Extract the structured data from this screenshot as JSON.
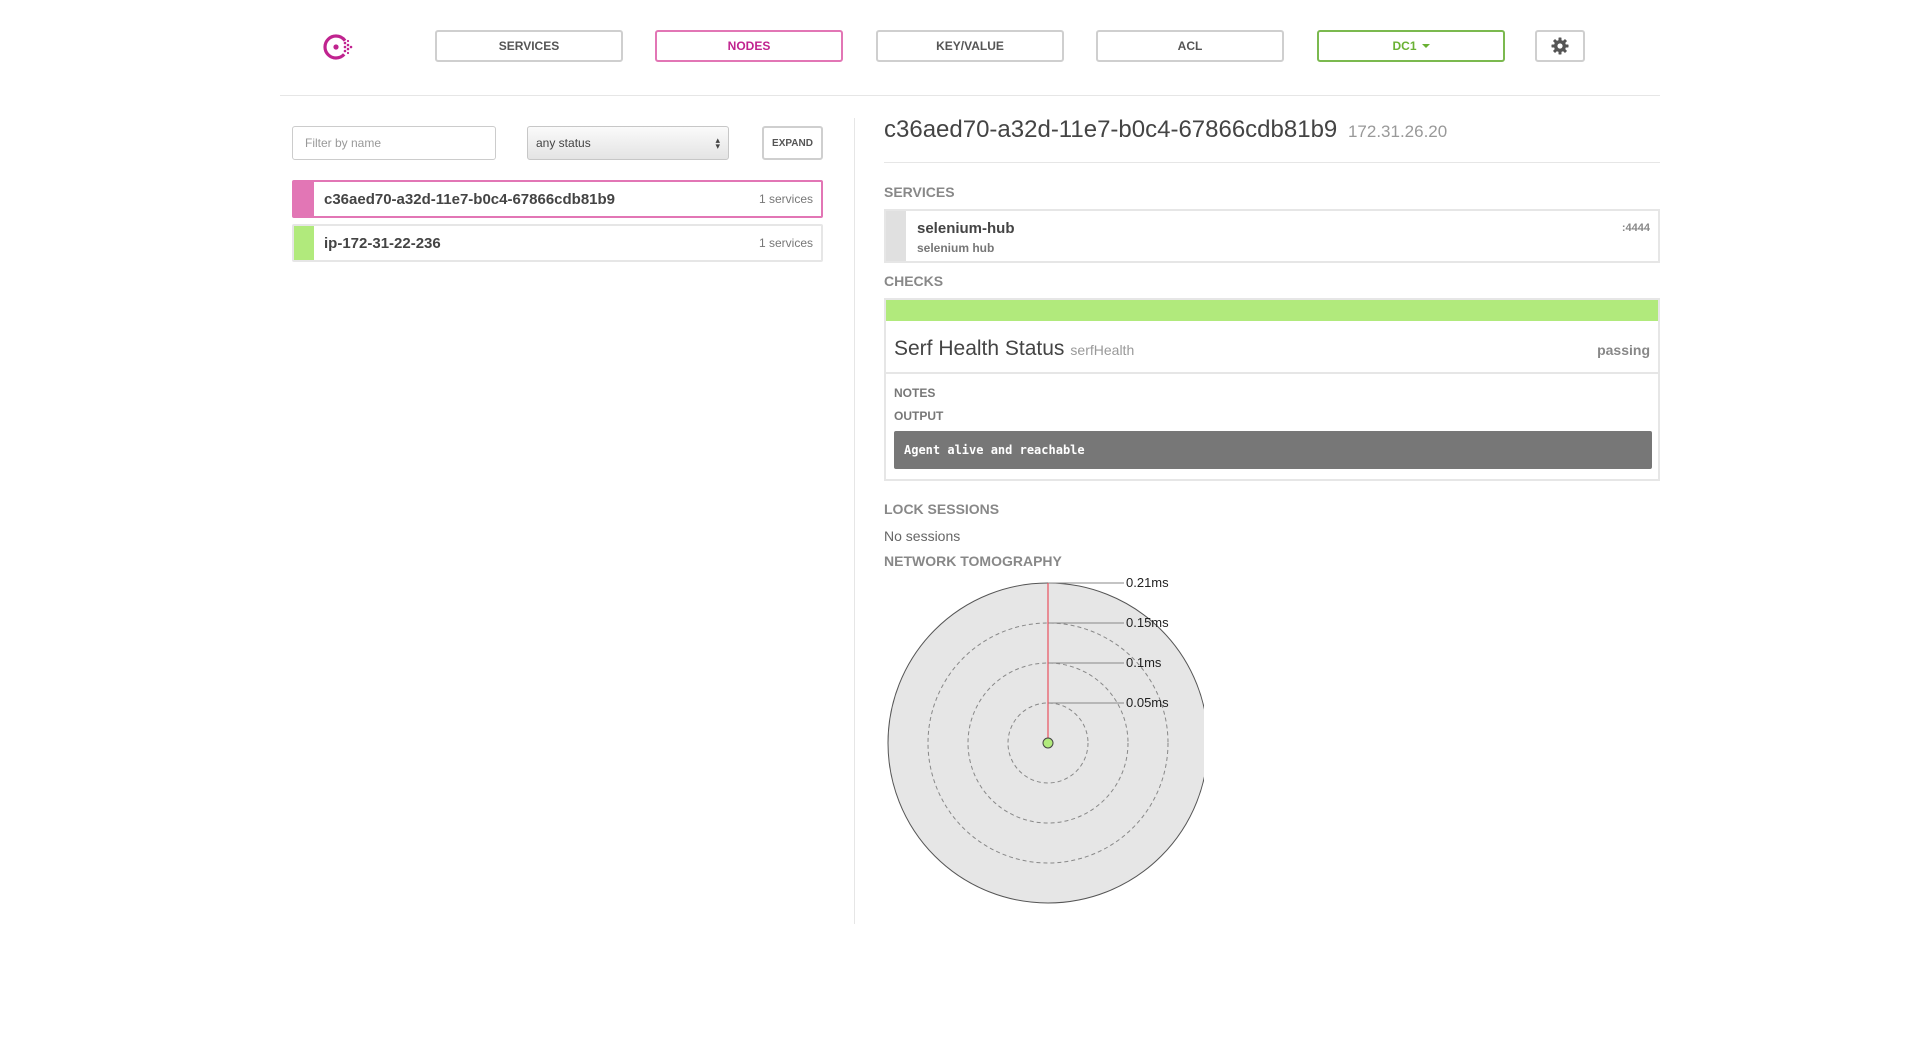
{
  "nav": {
    "services": "SERVICES",
    "nodes": "NODES",
    "keyvalue": "KEY/VALUE",
    "acl": "ACL",
    "dc": "DC1"
  },
  "colors": {
    "brand": "#c0238f",
    "passing": "#b1ea7c",
    "critical": "#e276b5",
    "dc": "#69b133"
  },
  "filter": {
    "placeholder": "Filter by name",
    "status": "any status",
    "expand": "EXPAND"
  },
  "nodes": [
    {
      "name": "c36aed70-a32d-11e7-b0c4-67866cdb81b9",
      "count": "1 services",
      "status": "critical",
      "selected": true
    },
    {
      "name": "ip-172-31-22-236",
      "count": "1 services",
      "status": "passing",
      "selected": false
    }
  ],
  "detail": {
    "title": "c36aed70-a32d-11e7-b0c4-67866cdb81b9",
    "ip": "172.31.26.20",
    "services_heading": "SERVICES",
    "service": {
      "name": "selenium-hub",
      "tag": "selenium hub",
      "port": ":4444"
    },
    "checks_heading": "CHECKS",
    "check": {
      "name": "Serf Health Status",
      "id": "serfHealth",
      "status": "passing",
      "notes_label": "NOTES",
      "output_label": "OUTPUT",
      "output": "Agent alive and reachable"
    },
    "lock_heading": "LOCK SESSIONS",
    "lock_text": "No sessions",
    "tomo_heading": "NETWORK TOMOGRAPHY",
    "tomo_labels": [
      "0.21ms",
      "0.15ms",
      "0.1ms",
      "0.05ms"
    ]
  }
}
